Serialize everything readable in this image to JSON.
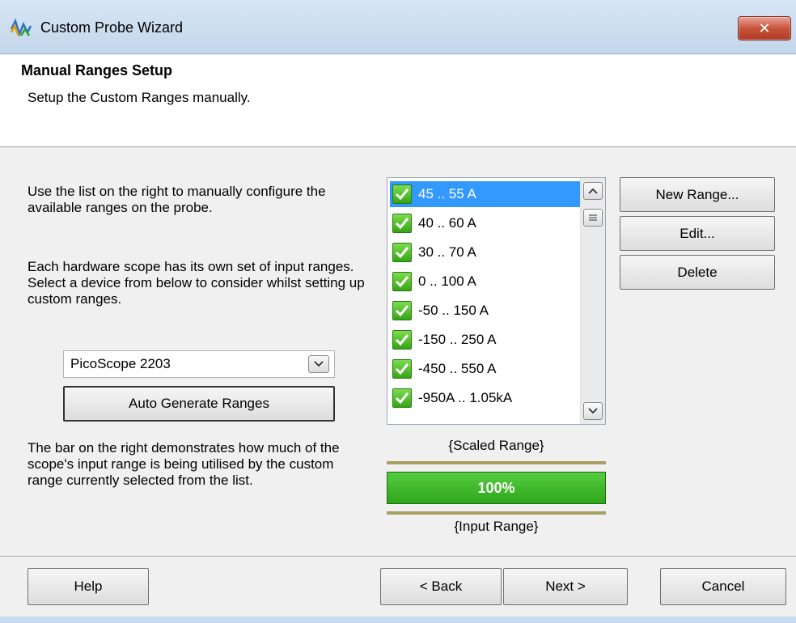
{
  "window": {
    "title": "Custom Probe Wizard",
    "close_label": "✕"
  },
  "header": {
    "title": "Manual Ranges Setup",
    "subtitle": "Setup the Custom Ranges manually."
  },
  "instructions": {
    "p1": "Use the list on the right to manually configure the available ranges on the probe.",
    "p2": "Each hardware scope has its own set of input ranges. Select a device from below to consider whilst setting up custom ranges.",
    "p3": "The bar on the right demonstrates how much of the scope's input range is being utilised by the custom range currently selected from the list."
  },
  "device_select": {
    "value": "PicoScope 2203"
  },
  "auto_generate_label": "Auto Generate Ranges",
  "ranges": {
    "items": [
      {
        "label": "45 .. 55 A",
        "checked": true,
        "selected": true
      },
      {
        "label": "40 .. 60 A",
        "checked": true
      },
      {
        "label": "30 .. 70 A",
        "checked": true
      },
      {
        "label": "0 .. 100 A",
        "checked": true
      },
      {
        "label": "-50 .. 150 A",
        "checked": true
      },
      {
        "label": "-150 .. 250 A",
        "checked": true
      },
      {
        "label": "-450 .. 550 A",
        "checked": true
      },
      {
        "label": "-950A .. 1.05kA",
        "checked": true
      }
    ]
  },
  "range_buttons": {
    "new_label": "New Range...",
    "edit_label": "Edit...",
    "delete_label": "Delete"
  },
  "usage": {
    "scaled_label": "{Scaled Range}",
    "input_label": "{Input Range}",
    "percent_text": "100%",
    "fraction": 1.0
  },
  "footer": {
    "help_label": "Help",
    "back_label": "< Back",
    "next_label": "Next >",
    "cancel_label": "Cancel"
  },
  "colors": {
    "selection": "#3399ff",
    "bar_green": "#2ea61b",
    "close_red": "#c8543d"
  }
}
